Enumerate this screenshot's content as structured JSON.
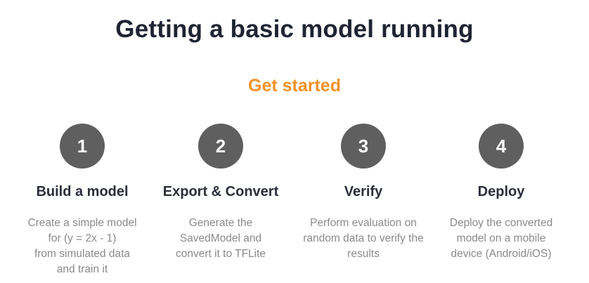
{
  "header": {
    "title": "Getting a basic model running",
    "cta_label": "Get started"
  },
  "steps": [
    {
      "number": "1",
      "title": "Build a model",
      "description": "Create a simple model\nfor (y = 2x - 1)\nfrom simulated data\nand train it"
    },
    {
      "number": "2",
      "title": "Export & Convert",
      "description": "Generate the\nSavedModel and\nconvert it to TFLite"
    },
    {
      "number": "3",
      "title": "Verify",
      "description": "Perform evaluation on\nrandom data to verify the\nresults"
    },
    {
      "number": "4",
      "title": "Deploy",
      "description": "Deploy the converted\nmodel on a mobile\ndevice (Android/iOS)"
    }
  ],
  "colors": {
    "accent": "#f0922a",
    "circle": "#5f5f5f",
    "title": "#1f2433",
    "muted": "#8a8a8a"
  }
}
